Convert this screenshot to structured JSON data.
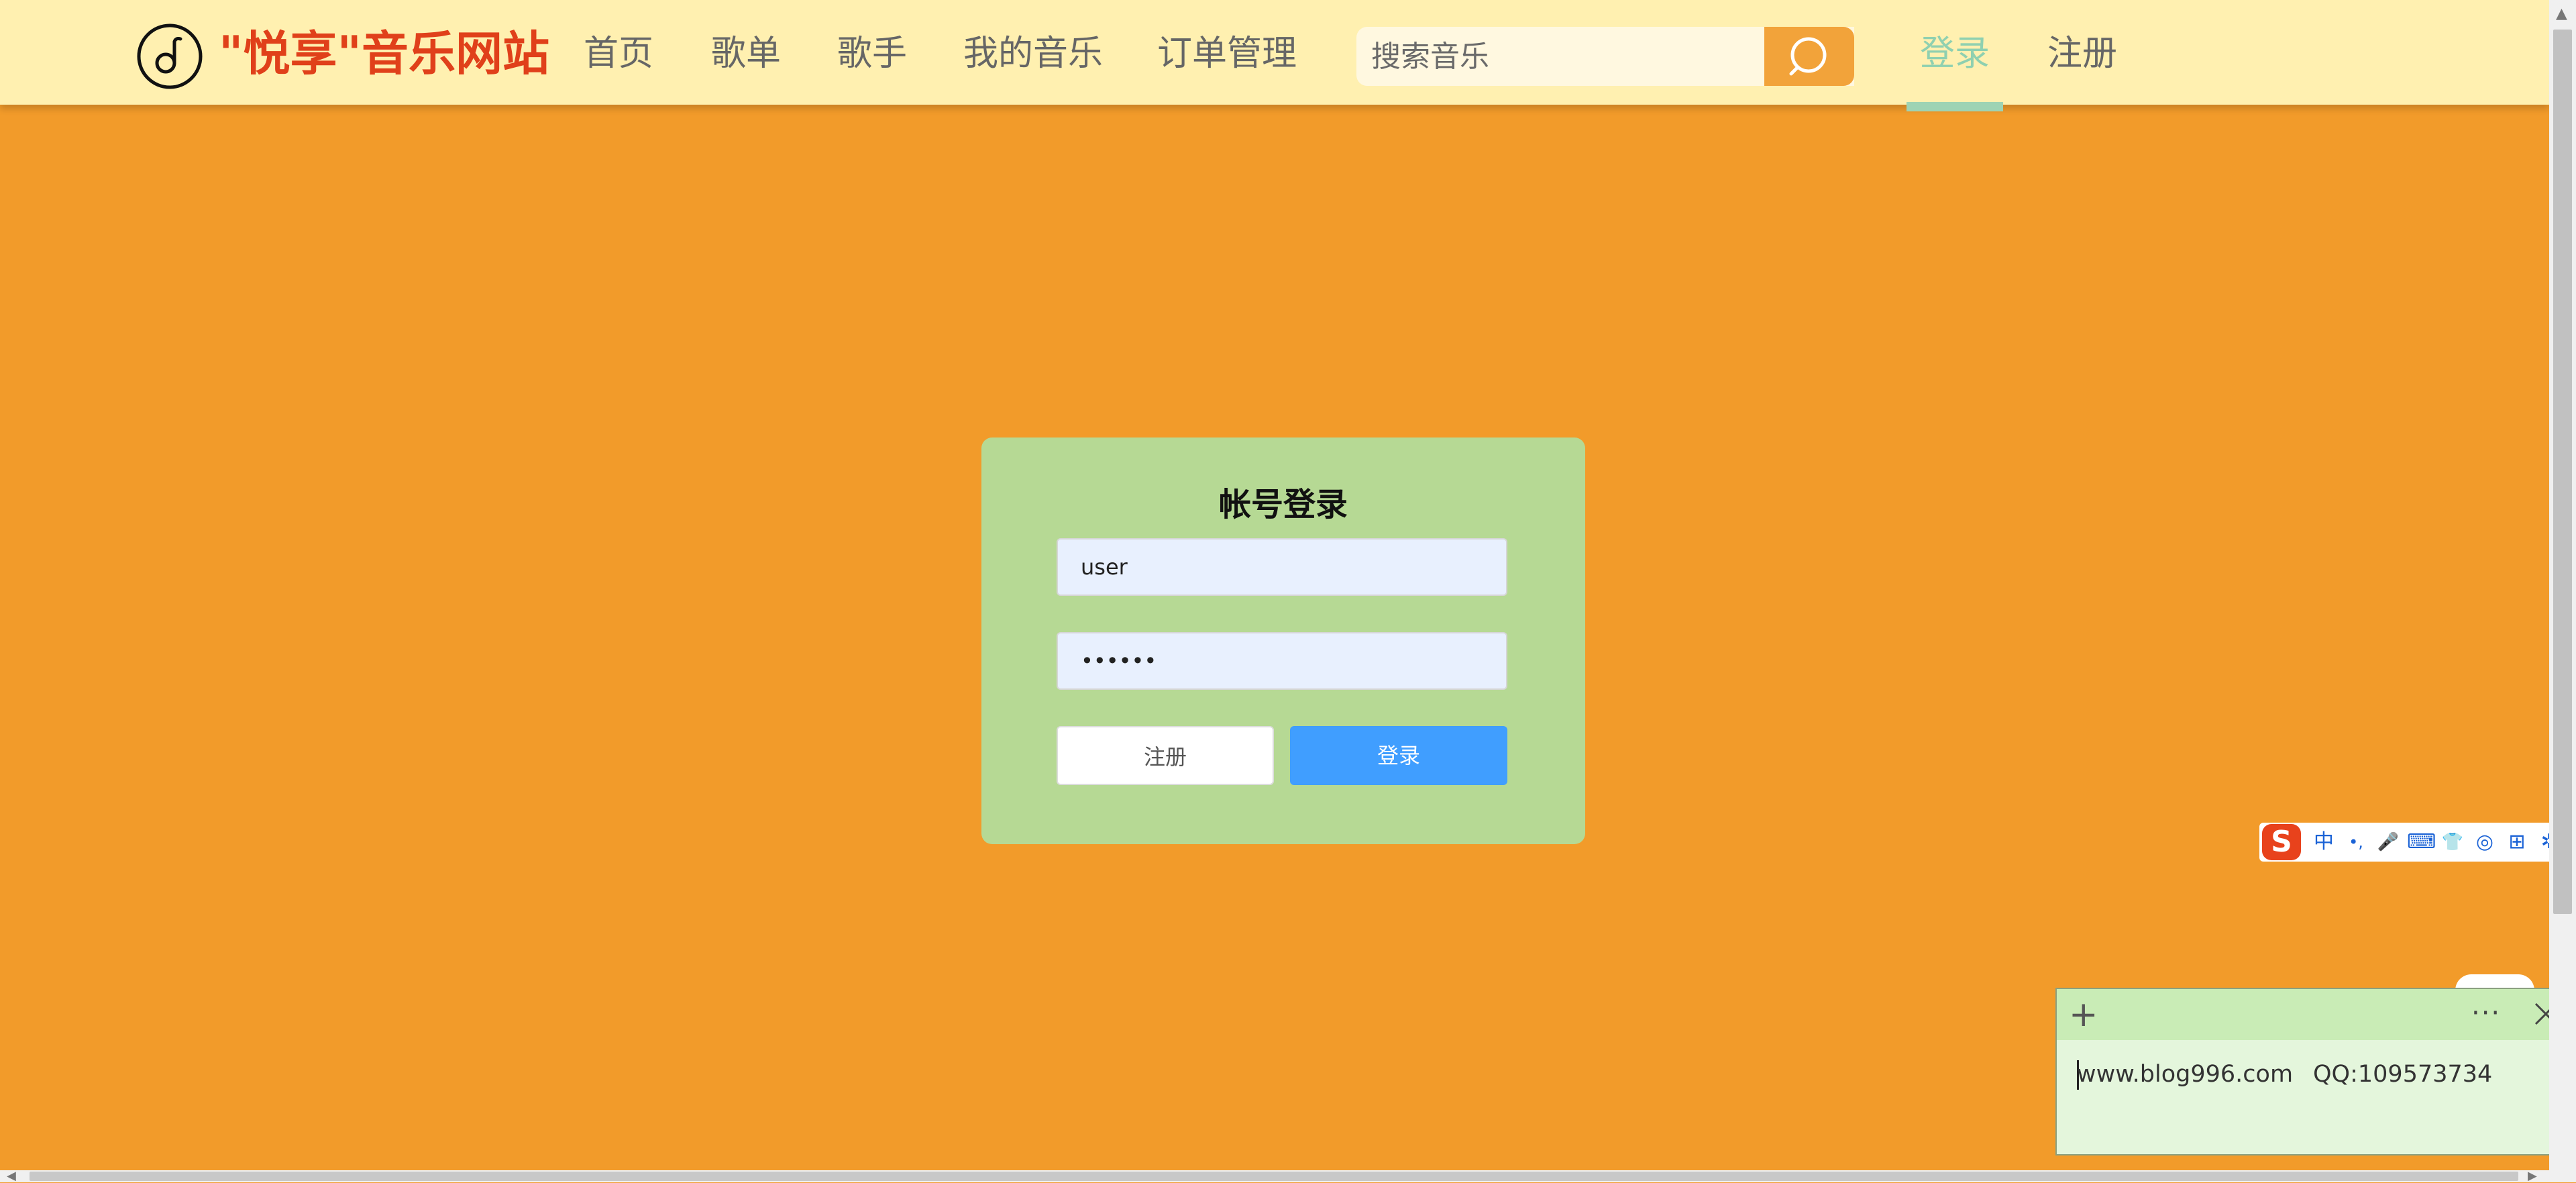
{
  "header": {
    "site_name": "\"悦享\"音乐网站",
    "nav": [
      "首页",
      "歌单",
      "歌手",
      "我的音乐",
      "订单管理"
    ],
    "search_placeholder": "搜索音乐",
    "login": "登录",
    "register": "注册"
  },
  "login_card": {
    "title": "帐号登录",
    "username_value": "user",
    "password_value": "••••••",
    "register_button": "注册",
    "login_button": "登录"
  },
  "ime": {
    "items": [
      "中",
      "•,",
      "🎤",
      "⌨",
      "👕",
      "◎",
      "⊞",
      "✲"
    ]
  },
  "sticky_note": {
    "text_site": "www.blog996.com",
    "text_qq": "QQ:109573734"
  },
  "colors": {
    "page_bg": "#f29b2a",
    "header_bg": "#fff0b0",
    "brand": "#e0401a",
    "card_bg": "#b6d994",
    "primary_button": "#409eff",
    "active_link": "#9ed3b4"
  }
}
